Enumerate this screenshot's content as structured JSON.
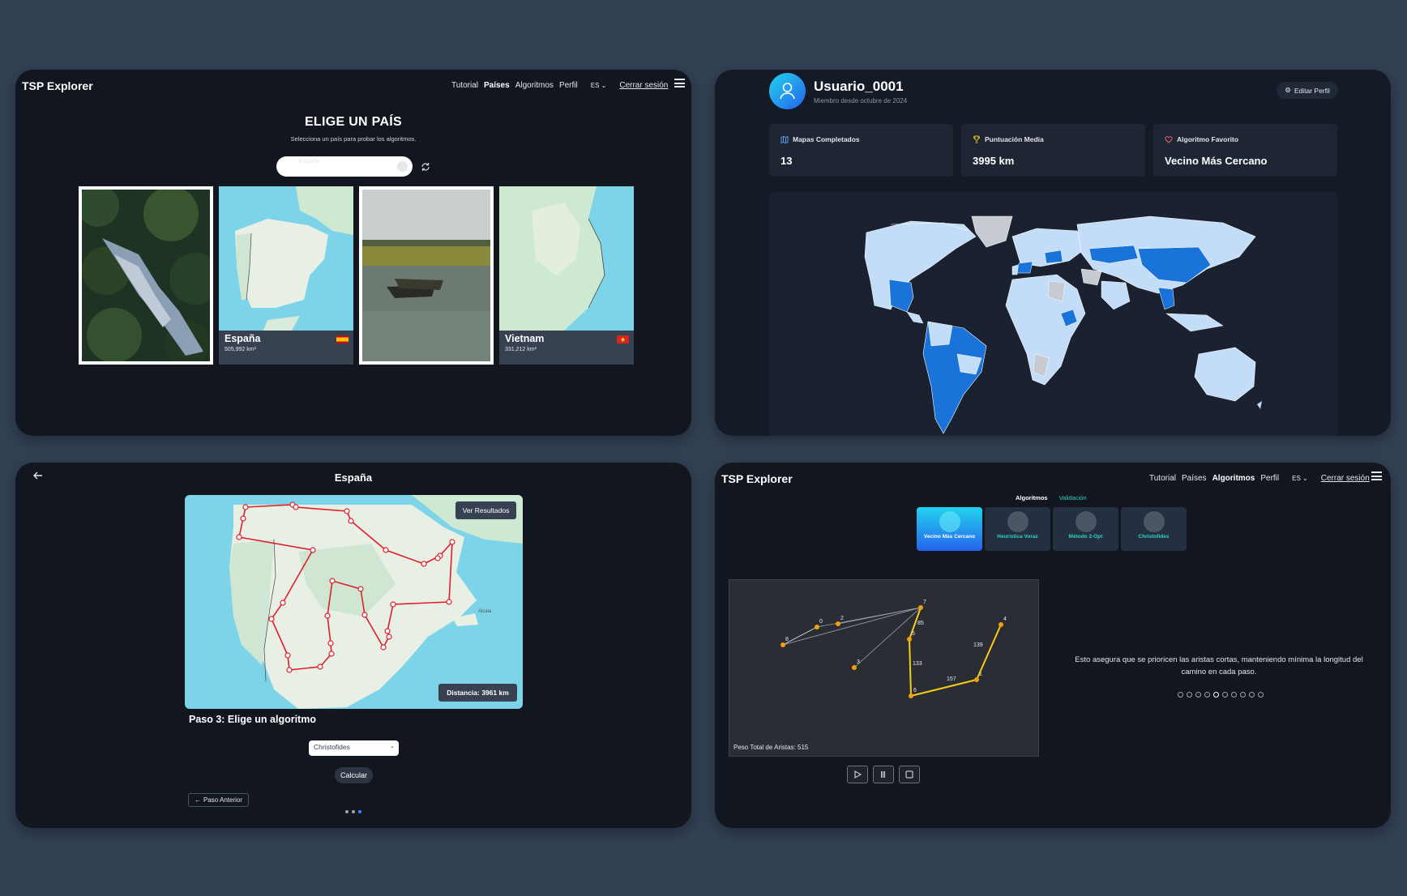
{
  "brand": "TSP Explorer",
  "nav": {
    "tutorial": "Tutorial",
    "countries": "Países",
    "algorithms": "Algoritmos",
    "profile": "Perfil",
    "lang": "ES",
    "logout": "Cerrar sesión"
  },
  "country_select": {
    "title": "ELIGE UN PAÍS",
    "subtitle": "Selecciona un país para probar los algoritmos.",
    "search_placeholder": "España",
    "cards": [
      {
        "name": "",
        "area": ""
      },
      {
        "name": "España",
        "area": "505,992 km²"
      },
      {
        "name": "",
        "area": ""
      },
      {
        "name": "Vietnam",
        "area": "331,212 km²"
      }
    ]
  },
  "profile": {
    "username": "Usuario_0001",
    "member_since": "Miembro desde octubre de 2024",
    "edit_button": "Editar Perfil",
    "stats": [
      {
        "label": "Mapas Completados",
        "value": "13",
        "icon": "map-icon"
      },
      {
        "label": "Puntuación Media",
        "value": "3995 km",
        "icon": "trophy-icon"
      },
      {
        "label": "Algoritmo Favorito",
        "value": "Vecino Más Cercano",
        "icon": "heart-icon"
      }
    ],
    "map_colors": {
      "visited": "#1a73d9",
      "land": "#c3dcf7",
      "unknown": "#c6cad1"
    }
  },
  "route": {
    "title": "España",
    "results_button": "Ver Resultados",
    "distance": "Distancia: 3961 km",
    "city_label": "Alcala",
    "step_title": "Paso 3: Elige un algoritmo",
    "selected_algorithm": "Christofides",
    "calculate_button": "Calcular",
    "previous_button": "Paso Anterior",
    "route_color": "#e11d2a"
  },
  "algorithms_view": {
    "tabs": {
      "algorithms": "Algoritmos",
      "validation": "Validación"
    },
    "cards": [
      {
        "label": "Vecino Más Cercano",
        "selected": true
      },
      {
        "label": "Heurística Voraz",
        "selected": false
      },
      {
        "label": "Método 2-Opt",
        "selected": false
      },
      {
        "label": "Christofides",
        "selected": false
      }
    ],
    "total_weight": "Peso Total de Aristas: 515",
    "description": "Esto asegura que se prioricen las aristas cortas, manteniendo mínima la longitud del camino en cada paso.",
    "node_labels": [
      "0",
      "1",
      "2",
      "3",
      "4",
      "5",
      "6",
      "7",
      "8"
    ],
    "edge_labels": [
      "85",
      "133",
      "157",
      "139"
    ],
    "step_dots": 10,
    "active_step": 5,
    "edge_color": "#facc15"
  }
}
